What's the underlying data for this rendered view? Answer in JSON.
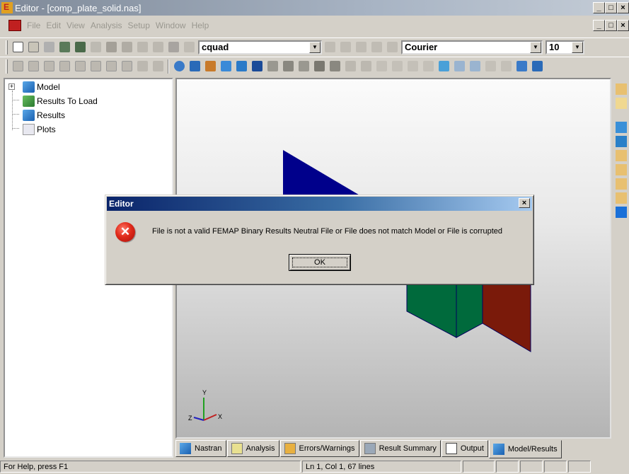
{
  "window": {
    "title": "Editor - [comp_plate_solid.nas]",
    "controls": {
      "minimize": "_",
      "maximize": "□",
      "close": "×"
    }
  },
  "menu": {
    "items": [
      "File",
      "Edit",
      "View",
      "Analysis",
      "Setup",
      "Window",
      "Help"
    ]
  },
  "toolbar": {
    "element_type_combo": "cquad",
    "font_combo": "Courier",
    "font_size_combo": "10"
  },
  "tree": {
    "items": [
      {
        "label": "Model",
        "icon": "model-cube-icon",
        "expander": "+"
      },
      {
        "label": "Results To Load",
        "icon": "results-to-load-icon"
      },
      {
        "label": "Results",
        "icon": "results-icon"
      },
      {
        "label": "Plots",
        "icon": "plots-icon"
      }
    ]
  },
  "viewport": {
    "triad": {
      "y": "Y",
      "x": "X",
      "z": "Z"
    },
    "colors": {
      "blue": "#00008b",
      "green": "#006a3c",
      "red": "#7a1a0a"
    }
  },
  "tabs": [
    {
      "label": "Nastran",
      "icon": "nastran-icon"
    },
    {
      "label": "Analysis",
      "icon": "analysis-icon"
    },
    {
      "label": "Errors/Warnings",
      "icon": "errors-warnings-icon"
    },
    {
      "label": "Result Summary",
      "icon": "result-summary-icon"
    },
    {
      "label": "Output",
      "icon": "output-icon"
    },
    {
      "label": "Model/Results",
      "icon": "model-results-icon",
      "active": true
    }
  ],
  "status": {
    "help": "For Help, press F1",
    "position": "Ln 1, Col 1, 67 lines"
  },
  "dialog": {
    "title": "Editor",
    "close": "×",
    "icon": "error-icon",
    "message": "File is not a valid FEMAP Binary Results Neutral File or File does not match Model or File is corrupted",
    "ok_label": "OK"
  }
}
